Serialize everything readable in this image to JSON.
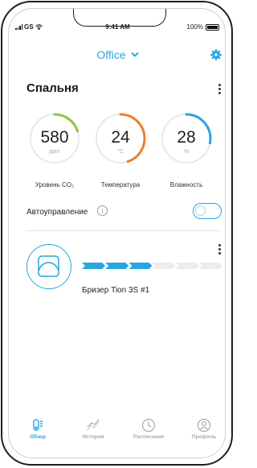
{
  "status": {
    "carrier": "GS",
    "time": "9:41 AM",
    "battery": "100%"
  },
  "header": {
    "location": "Office",
    "settings_icon": "gear-icon",
    "accent": "#27a6e0"
  },
  "room": {
    "title": "Спальня"
  },
  "gauges": [
    {
      "value": "580",
      "unit": "ppm",
      "label": "Уровень CO₂",
      "fraction": 0.2,
      "color": "#8cc640"
    },
    {
      "value": "24",
      "unit": "°C",
      "label": "Температура",
      "fraction": 0.45,
      "color": "#f07d2a"
    },
    {
      "value": "28",
      "unit": "%",
      "label": "Влажность",
      "fraction": 0.28,
      "color": "#27a6e0"
    }
  ],
  "auto": {
    "label": "Автоуправление",
    "info": "i",
    "enabled": false
  },
  "device": {
    "name": "Бризер Tion 3S #1",
    "speed_level": 3,
    "speed_max": 6
  },
  "tabs": [
    {
      "label": "Обзор",
      "icon": "overview-icon",
      "active": true
    },
    {
      "label": "История",
      "icon": "history-icon",
      "active": false
    },
    {
      "label": "Расписание",
      "icon": "schedule-icon",
      "active": false
    },
    {
      "label": "Профиль",
      "icon": "profile-icon",
      "active": false
    }
  ]
}
